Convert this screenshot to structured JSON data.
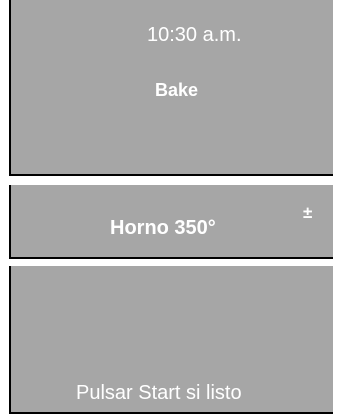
{
  "clock": {
    "time": "10:30 a.m."
  },
  "status": {
    "mode": "Bake"
  },
  "temperature": {
    "label": "Horno 350°",
    "adjust_symbol": "±"
  },
  "footer": {
    "prompt": "Pulsar Start si listo"
  }
}
